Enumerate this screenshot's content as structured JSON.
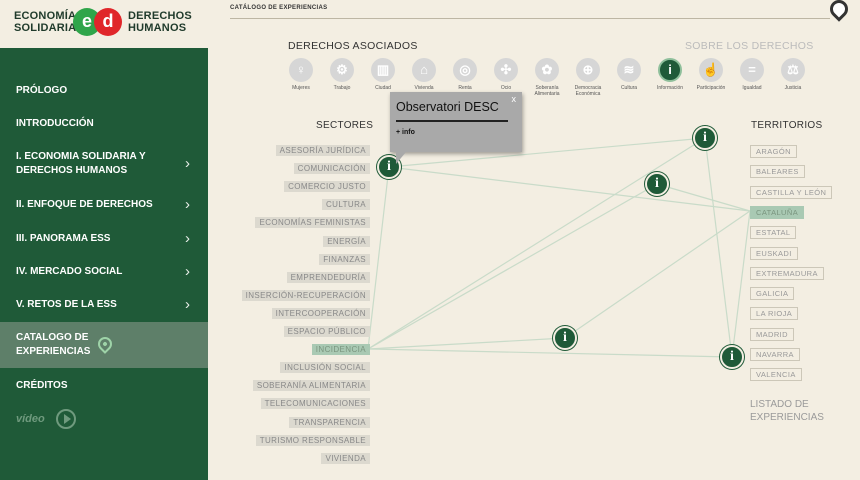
{
  "logo": {
    "left_line1": "ECONOMÍA",
    "left_line2": "SOLIDARIA",
    "e": "e",
    "d": "d",
    "right_line1": "DERECHOS",
    "right_line2": "HUMANOS"
  },
  "nav": {
    "prologo": "PRÓLOGO",
    "introduccion": "INTRODUCCIÓN",
    "item1_l1": "I. ECONOMIA SOLIDARIA Y",
    "item1_l2": "DERECHOS HUMANOS",
    "item2": "II. ENFOQUE DE DERECHOS",
    "item3": "III. PANORAMA ESS",
    "item4": "IV. MERCADO SOCIAL",
    "item5": "V. RETOS DE LA ESS",
    "catalogo_l1": "CATALOGO DE",
    "catalogo_l2": "EXPERIENCIAS",
    "creditos": "CRÉDITOS",
    "video": "vídeo",
    "chevron": "›"
  },
  "main": {
    "page_title": "CATÁLOGO DE EXPERIENCIAS",
    "derechos_title": "DERECHOS ASOCIADOS",
    "sobre_link": "SOBRE LOS DERECHOS",
    "sectores_title": "SECTORES",
    "territorios_title": "TERRITORIOS",
    "listado_l1": "LISTADO DE",
    "listado_l2": "EXPERIENCIAS"
  },
  "rights": [
    {
      "label": "Mujeres",
      "icon": "women-icon",
      "glyph": "♀"
    },
    {
      "label": "Trabajo",
      "icon": "work-icon",
      "glyph": "⚙"
    },
    {
      "label": "Ciudad",
      "icon": "city-icon",
      "glyph": "▥"
    },
    {
      "label": "Vivienda",
      "icon": "housing-icon",
      "glyph": "⌂"
    },
    {
      "label": "Renta",
      "icon": "income-icon",
      "glyph": "◎"
    },
    {
      "label": "Ocio",
      "icon": "leisure-icon",
      "glyph": "✣"
    },
    {
      "label": "Soberanía Alimentaria",
      "icon": "food-sovereignty-icon",
      "glyph": "✿"
    },
    {
      "label": "Democracia Económica",
      "icon": "economic-democracy-icon",
      "glyph": "⊕"
    },
    {
      "label": "Cultura",
      "icon": "culture-icon",
      "glyph": "≋"
    },
    {
      "label": "Información",
      "icon": "information-icon",
      "glyph": "i",
      "active": true
    },
    {
      "label": "Participación",
      "icon": "participation-icon",
      "glyph": "☝"
    },
    {
      "label": "Igualdad",
      "icon": "equality-icon",
      "glyph": "="
    },
    {
      "label": "Justicia",
      "icon": "justice-icon",
      "glyph": "⚖"
    }
  ],
  "sectores": [
    "ASESORÍA JURÍDICA",
    "COMUNICACIÓN",
    "COMERCIO JUSTO",
    "CULTURA",
    "ECONOMÍAS FEMINISTAS",
    "ENERGÍA",
    "FINANZAS",
    "EMPRENDEDURÍA",
    "INSERCIÓN-RECUPERACIÓN",
    "INTERCOOPERACIÓN",
    "ESPACIO PÚBLICO",
    "INCIDENCIA",
    "INCLUSIÓN SOCIAL",
    "SOBERANÍA ALIMENTARIA",
    "TELECOMUNICACIONES",
    "TRANSPARENCIA",
    "TURISMO RESPONSABLE",
    "VIVIENDA"
  ],
  "sector_active": "INCIDENCIA",
  "territorios": [
    "ARAGÓN",
    "BALEARES",
    "CASTILLA Y LEÓN",
    "CATALUÑA",
    "ESTATAL",
    "EUSKADI",
    "EXTREMADURA",
    "GALICIA",
    "LA RIOJA",
    "MADRID",
    "NAVARRA",
    "VALENCIA"
  ],
  "territorio_active": "CATALUÑA",
  "popup": {
    "title": "Observatori DESC",
    "close": "x",
    "info": "+ info"
  },
  "node_glyph": "i",
  "colors": {
    "sidebar": "#1f5a38",
    "background": "#f3eee2",
    "accent": "#1f5a38",
    "active_tag": "#a9c9b3"
  }
}
